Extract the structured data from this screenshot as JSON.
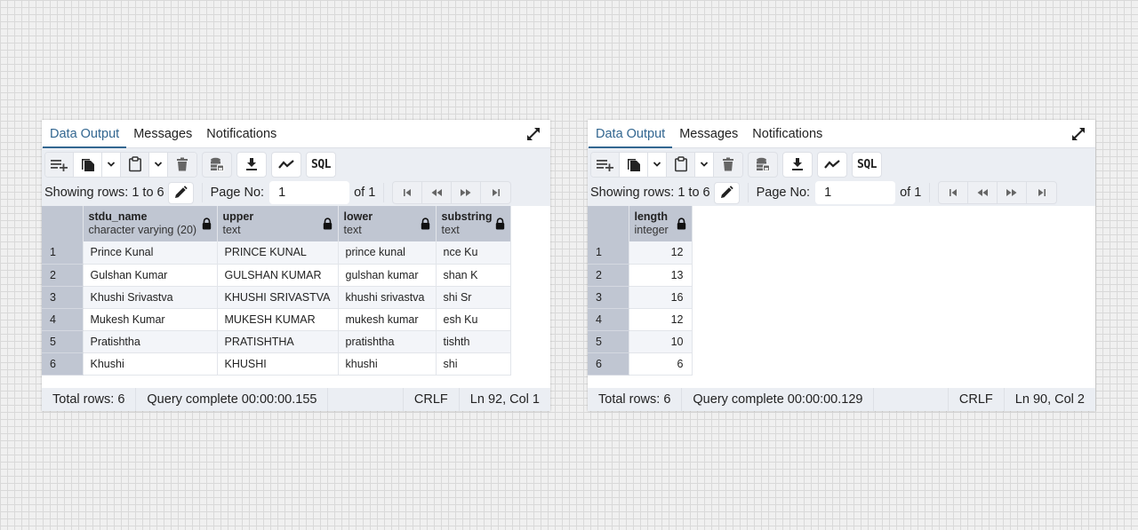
{
  "panels": [
    {
      "tabs": [
        {
          "label": "Data Output",
          "active": true
        },
        {
          "label": "Messages",
          "active": false
        },
        {
          "label": "Notifications",
          "active": false
        }
      ],
      "toolbar": {
        "add_row": "add-row-icon",
        "copy": "copy-icon",
        "copy_dropdown": "chevron-down-icon",
        "paste": "paste-icon",
        "paste_dropdown": "chevron-down-icon",
        "delete": "trash-icon",
        "save_data": "database-save-icon",
        "download": "download-icon",
        "graph": "graph-icon",
        "sql_label": "SQL"
      },
      "pager": {
        "showing_label": "Showing rows: 1 to 6",
        "page_no_label": "Page No:",
        "page_value": "1",
        "of_label": "of 1"
      },
      "columns": [
        {
          "name": "stdu_name",
          "type": "character varying (20)"
        },
        {
          "name": "upper",
          "type": "text"
        },
        {
          "name": "lower",
          "type": "text"
        },
        {
          "name": "substring",
          "type": "text"
        }
      ],
      "rows": [
        {
          "n": "1",
          "cells": [
            "Prince Kunal",
            "PRINCE KUNAL",
            "prince kunal",
            "nce Ku"
          ]
        },
        {
          "n": "2",
          "cells": [
            "Gulshan Kumar",
            "GULSHAN KUMAR",
            "gulshan kumar",
            "shan K"
          ]
        },
        {
          "n": "3",
          "cells": [
            "Khushi Srivastva",
            "KHUSHI SRIVASTVA",
            "khushi srivastva",
            "shi Sr"
          ]
        },
        {
          "n": "4",
          "cells": [
            "Mukesh Kumar",
            "MUKESH KUMAR",
            "mukesh kumar",
            "esh Ku"
          ]
        },
        {
          "n": "5",
          "cells": [
            "Pratishtha",
            "PRATISHTHA",
            "pratishtha",
            "tishth"
          ]
        },
        {
          "n": "6",
          "cells": [
            "Khushi",
            "KHUSHI",
            "khushi",
            "shi"
          ]
        }
      ],
      "status": {
        "total_rows": "Total rows: 6",
        "query": "Query complete 00:00:00.155",
        "eol": "CRLF",
        "position": "Ln 92, Col 1"
      }
    },
    {
      "tabs": [
        {
          "label": "Data Output",
          "active": true
        },
        {
          "label": "Messages",
          "active": false
        },
        {
          "label": "Notifications",
          "active": false
        }
      ],
      "toolbar": {
        "add_row": "add-row-icon",
        "copy": "copy-icon",
        "copy_dropdown": "chevron-down-icon",
        "paste": "paste-icon",
        "paste_dropdown": "chevron-down-icon",
        "delete": "trash-icon",
        "save_data": "database-save-icon",
        "download": "download-icon",
        "graph": "graph-icon",
        "sql_label": "SQL"
      },
      "pager": {
        "showing_label": "Showing rows: 1 to 6",
        "page_no_label": "Page No:",
        "page_value": "1",
        "of_label": "of 1"
      },
      "columns": [
        {
          "name": "length",
          "type": "integer"
        }
      ],
      "rows": [
        {
          "n": "1",
          "cells": [
            "12"
          ]
        },
        {
          "n": "2",
          "cells": [
            "13"
          ]
        },
        {
          "n": "3",
          "cells": [
            "16"
          ]
        },
        {
          "n": "4",
          "cells": [
            "12"
          ]
        },
        {
          "n": "5",
          "cells": [
            "10"
          ]
        },
        {
          "n": "6",
          "cells": [
            "6"
          ]
        }
      ],
      "status": {
        "total_rows": "Total rows: 6",
        "query": "Query complete 00:00:00.129",
        "eol": "CRLF",
        "position": "Ln 90, Col 2"
      }
    }
  ],
  "colors": {
    "accent": "#326690",
    "toolbar_bg": "#ebeef3",
    "header_bg": "#c0c6d2",
    "stripe": "#f3f5f9"
  }
}
